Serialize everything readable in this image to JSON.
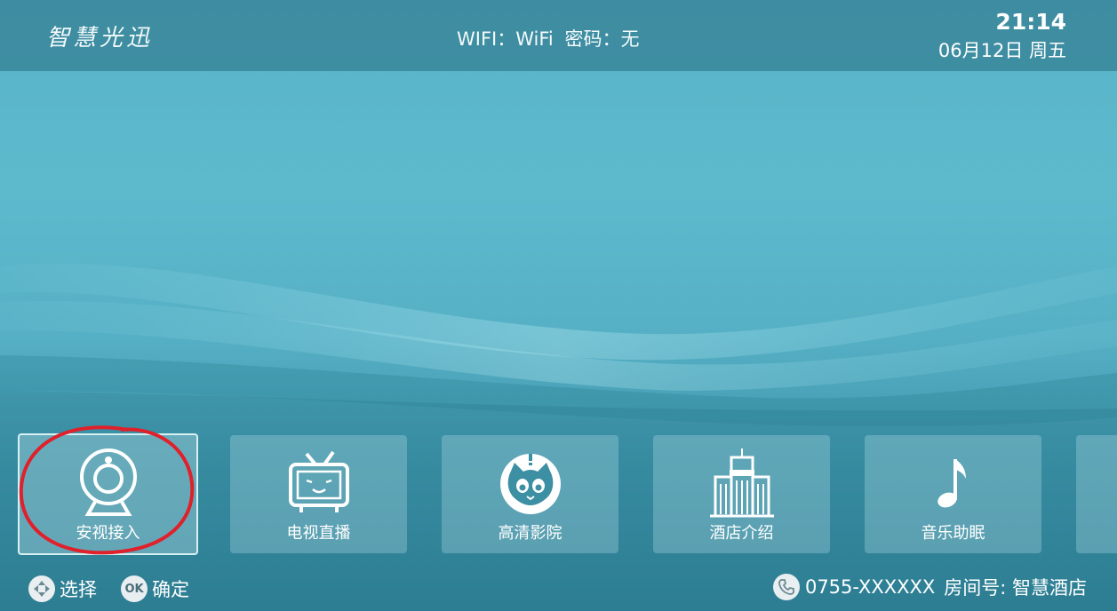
{
  "header": {
    "brand": "智慧光迅",
    "wifi_label": "WIFI：WiFi",
    "password_label": "密码：无",
    "time": "21:14",
    "date": "06月12日 周五"
  },
  "tiles": [
    {
      "label": "安视接入",
      "icon": "webcam-icon",
      "selected": true
    },
    {
      "label": "电视直播",
      "icon": "tv-icon"
    },
    {
      "label": "高清影院",
      "icon": "cat-icon"
    },
    {
      "label": "酒店介绍",
      "icon": "hotel-building-icon"
    },
    {
      "label": "音乐助眠",
      "icon": "music-note-icon"
    }
  ],
  "footer": {
    "select_hint": "选择",
    "ok_badge": "OK",
    "confirm_hint": "确定",
    "phone": "0755-XXXXXX",
    "room": "房间号: 智慧酒店"
  },
  "colors": {
    "accent": "#5dbacd",
    "annotation": "#e0202a"
  }
}
